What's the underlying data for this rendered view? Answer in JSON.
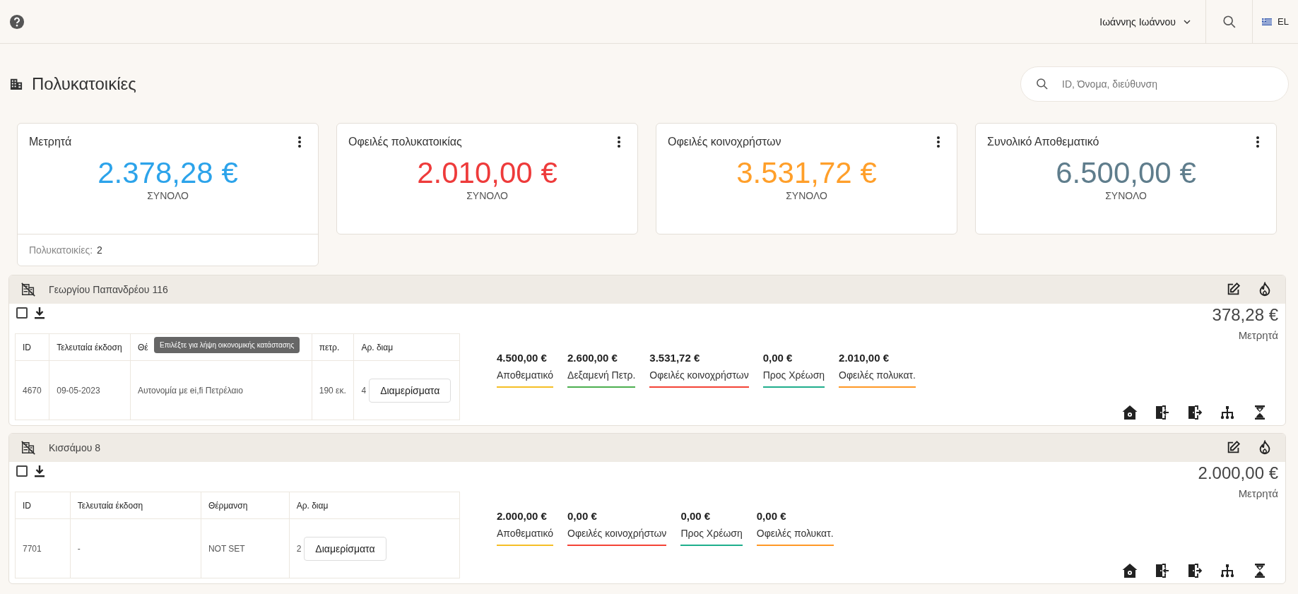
{
  "top_bar": {
    "user_name": "Ιωάννης Ιωάννου",
    "language": "EL"
  },
  "page": {
    "title": "Πολυκατοικίες",
    "search": {
      "placeholder": "ID, Όνομα, διεύθυνση"
    }
  },
  "summary_cards": [
    {
      "title": "Μετρητά",
      "amount": "2.378,28 €",
      "caption": "ΣΥΝΟΛΟ",
      "color": "#2ca3ea",
      "footer": {
        "label": "Πολυκατοικίες:",
        "value": "2"
      }
    },
    {
      "title": "Οφειλές πολυκατοικίας",
      "amount": "2.010,00 €",
      "caption": "ΣΥΝΟΛΟ",
      "color": "#ee3b3b"
    },
    {
      "title": "Οφειλές κοινοχρήστων",
      "amount": "3.531,72 €",
      "caption": "ΣΥΝΟΛΟ",
      "color": "#ff9f2a"
    },
    {
      "title": "Συνολικό Αποθεματικό",
      "amount": "6.500,00 €",
      "caption": "ΣΥΝΟΛΟ",
      "color": "#5f7d8c"
    }
  ],
  "buildings": [
    {
      "name": "Γεωργίου Παπανδρέου 116",
      "checked": false,
      "table": {
        "columns": [
          {
            "label": "ID"
          },
          {
            "label": "Τελευταία έκδοση"
          },
          {
            "label": "Θέ"
          },
          {
            "label": "πετρ."
          },
          {
            "label": "Αρ. διαμ"
          }
        ],
        "rows": [
          [
            {
              "kind": "text",
              "text": "4670"
            },
            {
              "kind": "text",
              "text": "09-05-2023"
            },
            {
              "kind": "text",
              "text": "Αυτονομία με ei,fi Πετρέλαιο"
            },
            {
              "kind": "text",
              "text": "190 εκ."
            },
            {
              "kind": "apartments",
              "count": "4",
              "button": "Διαμερίσματα"
            }
          ]
        ]
      },
      "tooltip": "Επιλέξτε για λήψη οικονομικής κατάστασης",
      "stats": [
        {
          "amount": "4.500,00 €",
          "label": "Αποθεματικό",
          "color": "#f5bf26"
        },
        {
          "amount": "2.600,00 €",
          "label": "Δεξαμενή Πετρ.",
          "color": "#4caf50"
        },
        {
          "amount": "3.531,72 €",
          "label": "Οφειλές κοινοχρήστων",
          "color": "#f44336"
        },
        {
          "amount": "0,00 €",
          "label": "Προς Χρέωση",
          "color": "#1fae8c"
        },
        {
          "amount": "2.010,00 €",
          "label": "Οφειλές πολυκατ.",
          "color": "#ff9826"
        }
      ],
      "cash": {
        "amount": "378,28 €",
        "label": "Μετρητά"
      }
    },
    {
      "name": "Κισσάμου 8",
      "checked": false,
      "table": {
        "columns": [
          {
            "label": "ID"
          },
          {
            "label": "Τελευταία έκδοση"
          },
          {
            "label": "Θέρμανση"
          },
          {
            "label": "Αρ. διαμ"
          }
        ],
        "rows": [
          [
            {
              "kind": "text",
              "text": "7701"
            },
            {
              "kind": "text",
              "text": "-"
            },
            {
              "kind": "text",
              "text": "NOT SET"
            },
            {
              "kind": "apartments",
              "count": "2",
              "button": "Διαμερίσματα"
            }
          ]
        ]
      },
      "stats": [
        {
          "amount": "2.000,00 €",
          "label": "Αποθεματικό",
          "color": "#f5bf26"
        },
        {
          "amount": "0,00 €",
          "label": "Οφειλές κοινοχρήστων",
          "color": "#f44336"
        },
        {
          "amount": "0,00 €",
          "label": "Προς Χρέωση",
          "color": "#1fae8c"
        },
        {
          "amount": "0,00 €",
          "label": "Οφειλές πολυκατ.",
          "color": "#ff9826"
        }
      ],
      "cash": {
        "amount": "2.000,00 €",
        "label": "Μετρητά"
      }
    }
  ]
}
